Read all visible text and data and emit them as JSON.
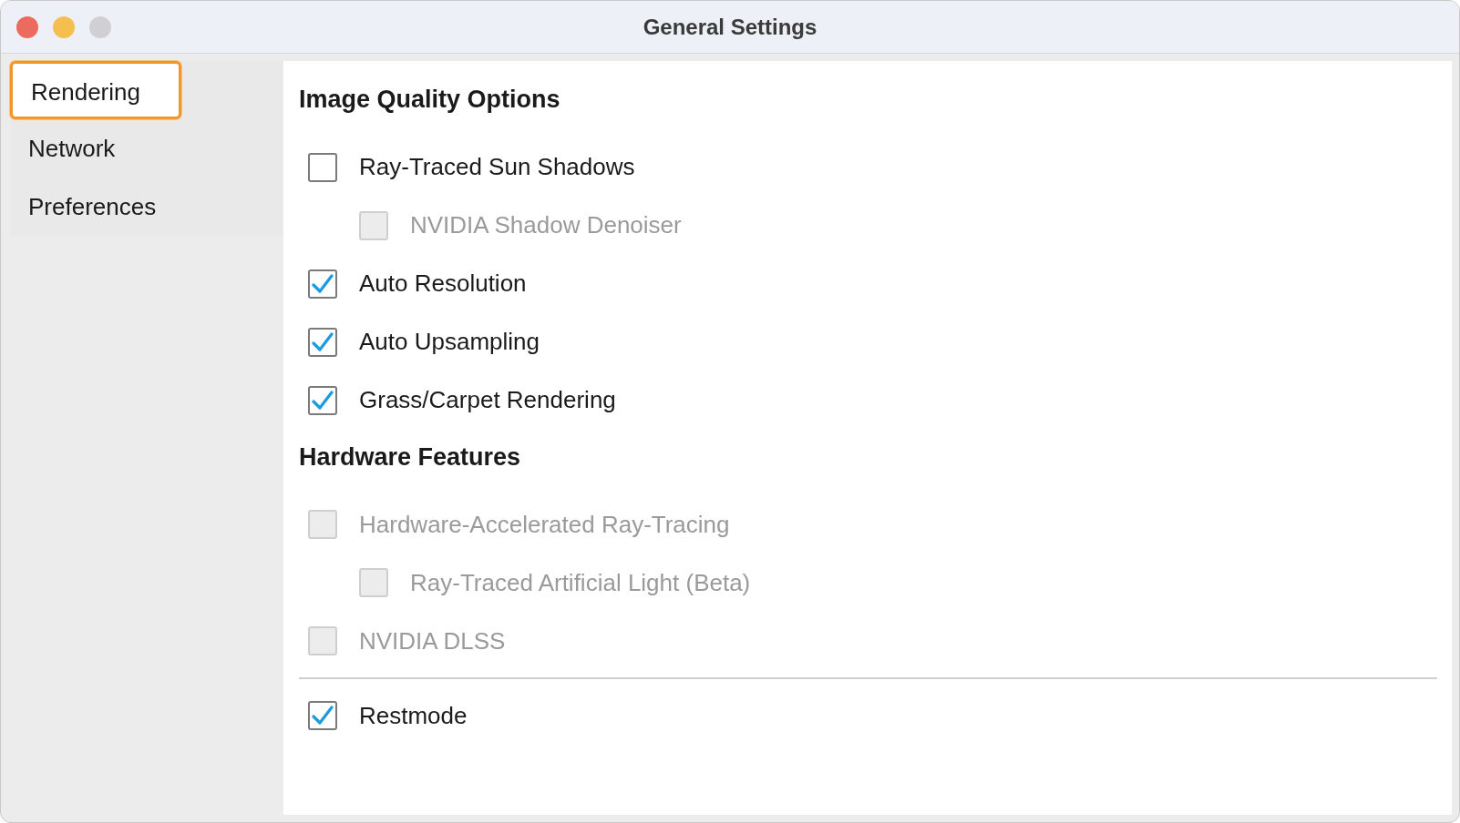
{
  "window": {
    "title": "General Settings"
  },
  "sidebar": {
    "items": [
      {
        "label": "Rendering",
        "selected": true
      },
      {
        "label": "Network",
        "selected": false
      },
      {
        "label": "Preferences",
        "selected": false
      }
    ]
  },
  "sections": [
    {
      "heading": "Image Quality Options",
      "options": [
        {
          "label": "Ray-Traced Sun Shadows",
          "checked": false,
          "disabled": false,
          "children": [
            {
              "label": "NVIDIA Shadow Denoiser",
              "checked": false,
              "disabled": true
            }
          ]
        },
        {
          "label": "Auto Resolution",
          "checked": true,
          "disabled": false
        },
        {
          "label": "Auto Upsampling",
          "checked": true,
          "disabled": false
        },
        {
          "label": "Grass/Carpet Rendering",
          "checked": true,
          "disabled": false
        }
      ]
    },
    {
      "heading": "Hardware Features",
      "options": [
        {
          "label": "Hardware-Accelerated Ray-Tracing",
          "checked": false,
          "disabled": true,
          "children": [
            {
              "label": "Ray-Traced Artificial Light (Beta)",
              "checked": false,
              "disabled": true
            }
          ]
        },
        {
          "label": "NVIDIA DLSS",
          "checked": false,
          "disabled": true
        }
      ]
    }
  ],
  "bottom_options": [
    {
      "label": "Restmode",
      "checked": true,
      "disabled": false
    }
  ]
}
